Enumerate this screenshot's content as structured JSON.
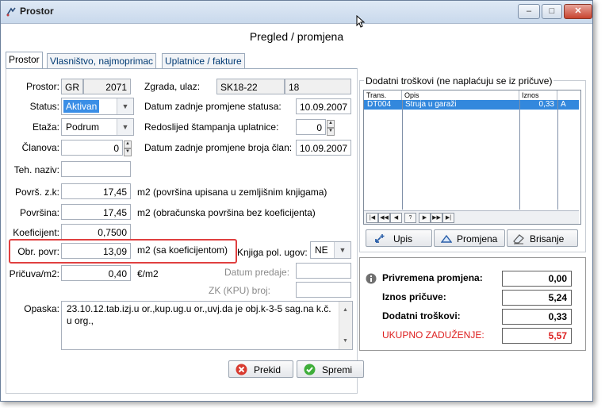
{
  "window": {
    "title": "Prostor",
    "minimize_label": "–",
    "maximize_label": "□",
    "close_label": "✕"
  },
  "form_title": "Pregled / promjena",
  "tabs": [
    {
      "label": "Prostor"
    },
    {
      "label": "Vlasništvo, najmoprimac"
    },
    {
      "label": "Uplatnice / fakture"
    }
  ],
  "fields": {
    "prostor": {
      "label": "Prostor:",
      "code": "GR",
      "number": "2071"
    },
    "zgrada": {
      "label": "Zgrada, ulaz:",
      "code": "SK18-22",
      "number": "18"
    },
    "status": {
      "label": "Status:",
      "value": "Aktivan"
    },
    "datum_status": {
      "label": "Datum zadnje promjene statusa:",
      "value": "10.09.2007"
    },
    "etaza": {
      "label": "Etaža:",
      "value": "Podrum"
    },
    "redoslijed": {
      "label": "Redoslijed štampanja uplatnice:",
      "value": "0"
    },
    "clanova": {
      "label": "Članova:",
      "value": "0"
    },
    "datum_clan": {
      "label": "Datum zadnje promjene broja član:",
      "value": "10.09.2007"
    },
    "teh_naziv": {
      "label": "Teh. naziv:",
      "value": ""
    },
    "povrs_zk": {
      "label": "Površ. z.k:",
      "value": "17,45",
      "note": "m2  (površina upisana u zemljišnim knjigama)"
    },
    "povrsina": {
      "label": "Površina:",
      "value": "17,45",
      "note": "m2  (obračunska površina bez koeficijenta)"
    },
    "koeficijent": {
      "label": "Koeficijent:",
      "value": "0,7500"
    },
    "obr_povr": {
      "label": "Obr. povr:",
      "value": "13,09",
      "note": "m2 (sa koeficijentom)"
    },
    "knjiga": {
      "label": "Knjiga pol. ugov:",
      "value": "NE"
    },
    "pricuva": {
      "label": "Pričuva/m2:",
      "value": "0,40",
      "note": "€/m2"
    },
    "datum_predaje": {
      "label": "Datum predaje:",
      "value": ""
    },
    "zk_broj": {
      "label": "ZK (KPU) broj:",
      "value": ""
    },
    "opaska": {
      "label": "Opaska:",
      "value": "23.10.12.tab.izj.u or.,kup.ug.u or.,uvj.da je obj.k-3-5  sag.na k.č. u org.,"
    }
  },
  "dodatni": {
    "title": "Dodatni troškovi  (ne naplaćuju se iz pričuve)",
    "columns": [
      "Trans.",
      "Opis",
      "Iznos"
    ],
    "rows": [
      {
        "trans": "DT004",
        "opis": "Struja u garaži",
        "iznos": "0,33",
        "flag": "A"
      }
    ],
    "nav": [
      "|◀",
      "◀◀",
      "◀",
      "?",
      "▶",
      "▶▶",
      "▶|"
    ],
    "buttons": {
      "upis": "Upis",
      "promjena": "Promjena",
      "brisanje": "Brisanje"
    }
  },
  "summary": {
    "privremena": {
      "label": "Privremena promjena:",
      "value": "0,00"
    },
    "iznos": {
      "label": "Iznos pričuve:",
      "value": "5,24"
    },
    "dodatni": {
      "label": "Dodatni troškovi:",
      "value": "0,33"
    },
    "ukupno": {
      "label": "UKUPNO ZADUŽENJE:",
      "value": "5,57"
    }
  },
  "buttons": {
    "prekid": "Prekid",
    "spremi": "Spremi"
  },
  "colors": {
    "selection": "#3388dd",
    "highlight_border": "#e04040",
    "total_red": "#dd1f1f"
  }
}
